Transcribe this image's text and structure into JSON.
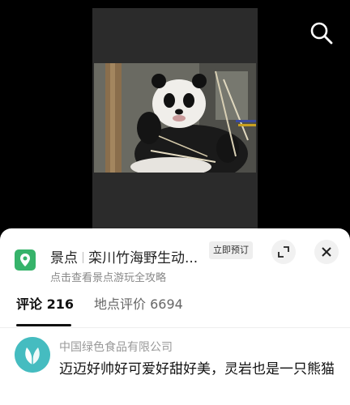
{
  "video": {
    "photo_subject": "giant panda",
    "search_icon": "search-icon"
  },
  "poi": {
    "icon": "map-pin-icon",
    "category": "景点",
    "name": "栾川竹海野生动...",
    "subtitle": "点击查看景点游玩全攻略",
    "book_label": "立即预订",
    "expand_icon": "expand-icon",
    "close_icon": "close-icon",
    "accent_color": "#36b36a"
  },
  "tabs": [
    {
      "label": "评论 216",
      "active": true
    },
    {
      "label": "地点评价 6694",
      "active": false
    }
  ],
  "comments": [
    {
      "user": "中国绿色食品有限公司",
      "text": "迈迈好帅好可爱好甜好美，灵岩也是一只熊猫",
      "avatar_icon": "leaf-logo-icon"
    }
  ]
}
